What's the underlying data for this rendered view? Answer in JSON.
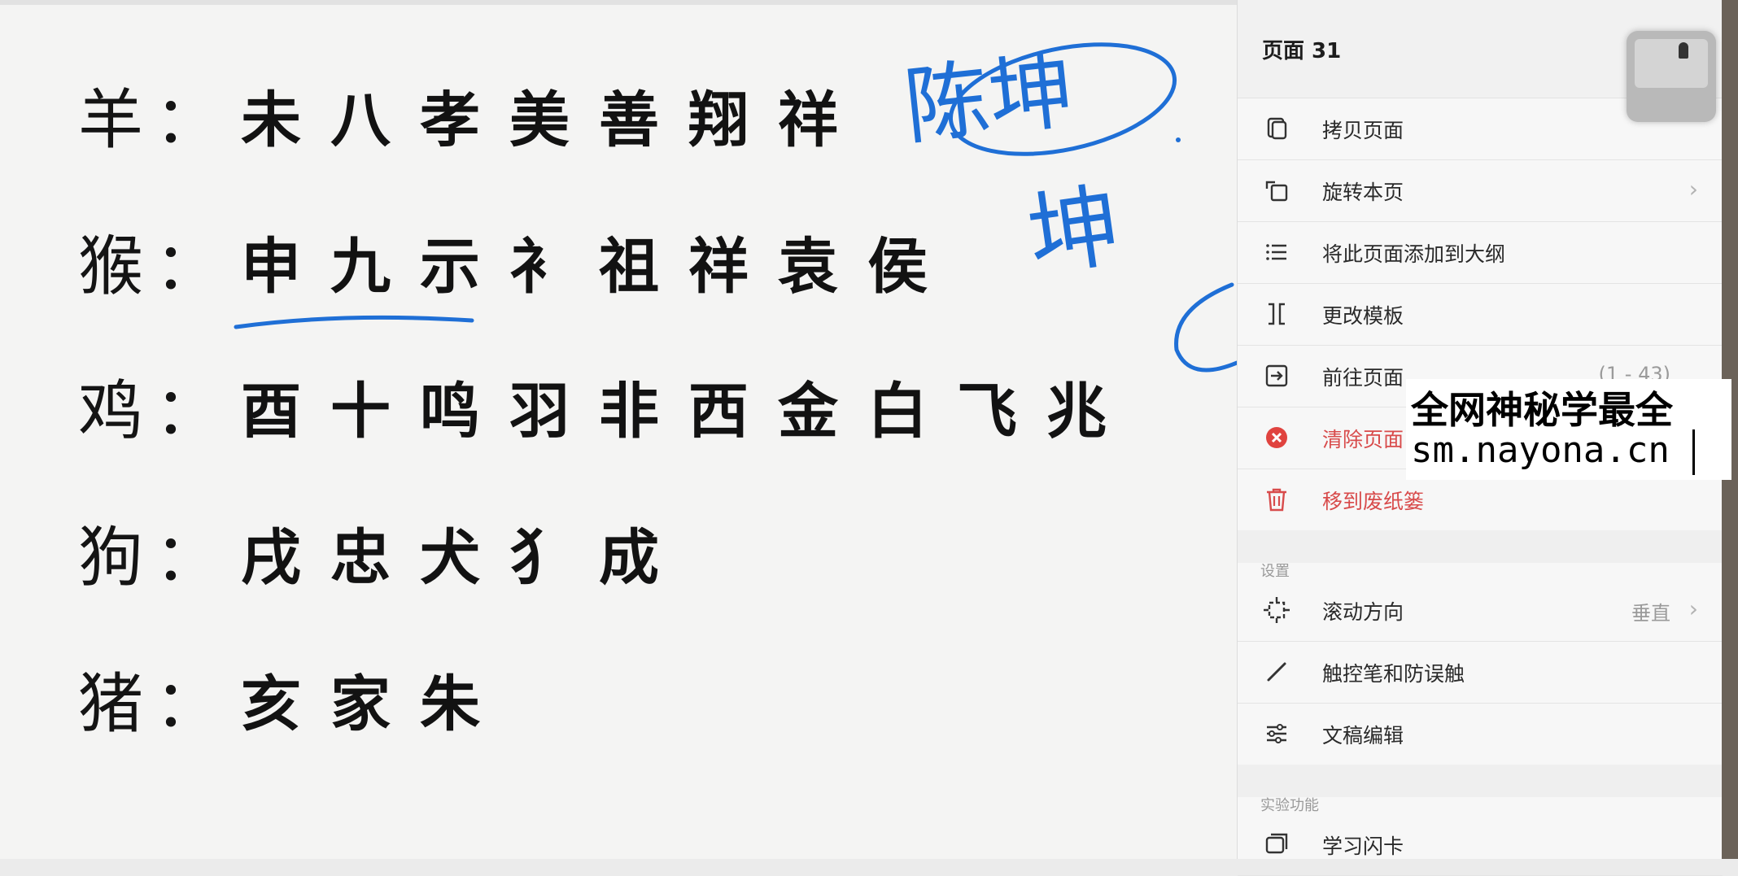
{
  "note": {
    "rows": [
      {
        "zodiac": "羊",
        "colon": "：",
        "chars": [
          "未",
          "八",
          "孝",
          "美",
          "善",
          "翔",
          "祥"
        ]
      },
      {
        "zodiac": "猴",
        "colon": "：",
        "chars": [
          "申",
          "九",
          "示",
          "衤",
          "祖",
          "祥",
          "袁",
          "侯"
        ]
      },
      {
        "zodiac": "鸡",
        "colon": "：",
        "chars": [
          "酉",
          "十",
          "鸣",
          "羽",
          "非",
          "西",
          "金",
          "白",
          "飞",
          "兆"
        ]
      },
      {
        "zodiac": "狗",
        "colon": "：",
        "chars": [
          "戌",
          "忠",
          "犬",
          "犭",
          "成"
        ]
      },
      {
        "zodiac": "猪",
        "colon": "：",
        "chars": [
          "亥",
          "家",
          "朱"
        ]
      }
    ],
    "handwriting": {
      "name_line1": "陈坤",
      "name_line2": "坤",
      "ink_color": "#1f6fd6"
    }
  },
  "panel": {
    "title": "页面 31",
    "items": [
      {
        "label": "拷贝页面",
        "icon": "copy-page-icon"
      },
      {
        "label": "旋转本页",
        "icon": "rotate-page-icon",
        "chevron": "›"
      },
      {
        "label": "将此页面添加到大纲",
        "icon": "outline-list-icon"
      },
      {
        "label": "更改模板",
        "icon": "template-icon"
      },
      {
        "label": "前往页面",
        "icon": "go-to-page-icon",
        "value": "(1 - 43)"
      },
      {
        "label": "清除页面",
        "icon": "clear-page-icon"
      },
      {
        "label": "移到废纸篓",
        "icon": "trash-icon"
      }
    ],
    "settings_section": "设置",
    "settings": [
      {
        "label": "滚动方向",
        "icon": "scroll-direction-icon",
        "value": "垂直",
        "chevron": "›"
      },
      {
        "label": "触控笔和防误触",
        "icon": "stylus-icon"
      },
      {
        "label": "文稿编辑",
        "icon": "document-edit-icon"
      }
    ],
    "experimental_section": "实验功能",
    "experimental": [
      {
        "label": "学习闪卡",
        "icon": "flashcard-icon"
      }
    ],
    "danger_color": "#d84b4b"
  },
  "watermark": {
    "line1": "全网神秘学最全",
    "line2": "sm.nayona.cn"
  }
}
